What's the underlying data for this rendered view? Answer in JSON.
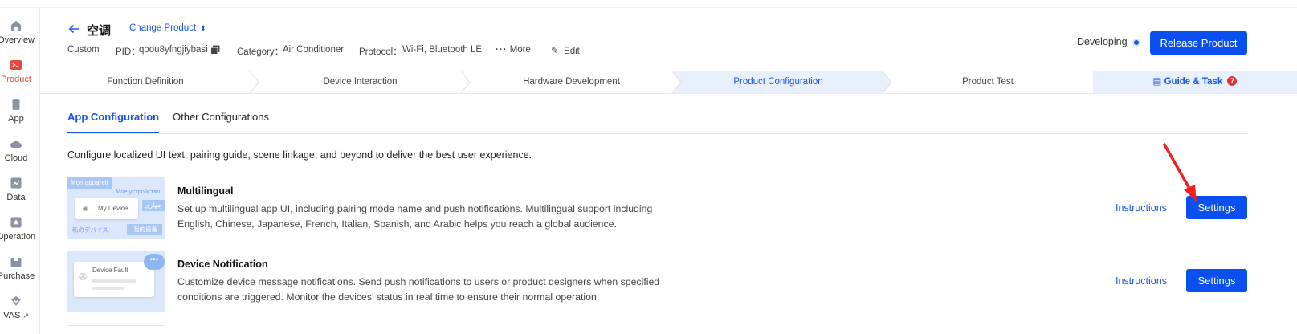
{
  "sidebar": {
    "items": [
      {
        "label": "Overview",
        "icon": "home-icon",
        "active": false
      },
      {
        "label": "Product",
        "icon": "terminal-icon",
        "active": true
      },
      {
        "label": "App",
        "icon": "phone-icon",
        "active": false
      },
      {
        "label": "Cloud",
        "icon": "cloud-icon",
        "active": false
      },
      {
        "label": "Data",
        "icon": "chart-icon",
        "active": false
      },
      {
        "label": "Operation",
        "icon": "star-icon",
        "active": false
      },
      {
        "label": "Purchase",
        "icon": "box-icon",
        "active": false
      },
      {
        "label": "VAS",
        "icon": "chevron-icon",
        "active": false
      }
    ]
  },
  "header": {
    "title": "空调",
    "change_product": "Change Product",
    "custom": "Custom",
    "pid_label": "PID：",
    "pid_value": "qoou8yfngjiybasi",
    "category_label": "Category：",
    "category_value": "Air Conditioner",
    "protocol_label": "Protocol：",
    "protocol_value": "Wi-Fi, Bluetooth LE",
    "more": "More",
    "edit": "Edit",
    "status": "Developing",
    "release_button": "Release Product"
  },
  "steps": [
    {
      "label": "Function Definition",
      "active": false
    },
    {
      "label": "Device Interaction",
      "active": false
    },
    {
      "label": "Hardware Development",
      "active": false
    },
    {
      "label": "Product Configuration",
      "active": true
    },
    {
      "label": "Product Test",
      "active": false
    }
  ],
  "guide": {
    "label": "Guide & Task",
    "badge": "7"
  },
  "tabs": [
    {
      "label": "App Configuration",
      "active": true
    },
    {
      "label": "Other Configurations",
      "active": false
    }
  ],
  "intro": "Configure localized UI text, pairing guide, scene linkage, and beyond to deliver the best user experience.",
  "cards": [
    {
      "title": "Multilingual",
      "desc_line1": "Set up multilingual app UI, including pairing mode name and push notifications. Multilingual support including",
      "desc_line2": "English, Chinese, Japanese, French, Italian, Spanish, and Arabic helps you reach a global audience.",
      "instructions": "Instructions",
      "settings": "Settings",
      "thumb": {
        "t1": "Mon appareil",
        "t2": "Мое устройство",
        "t3": "My Device",
        "t4": "جهازي",
        "t5": "私のデバイス",
        "t6": "我的设备"
      }
    },
    {
      "title": "Device Notification",
      "desc_line1": "Customize device message notifications. Send push notifications to users or product designers when specified",
      "desc_line2": "conditions are triggered. Monitor the devices' status in real time to ensure their normal operation.",
      "instructions": "Instructions",
      "settings": "Settings",
      "thumb": {
        "t1": "Device Fault"
      }
    }
  ],
  "colors": {
    "accent": "#0a50f0",
    "active_sidebar": "#e84b3c",
    "step_active_bg": "#e8f0fd",
    "annotation": "#f02020"
  }
}
